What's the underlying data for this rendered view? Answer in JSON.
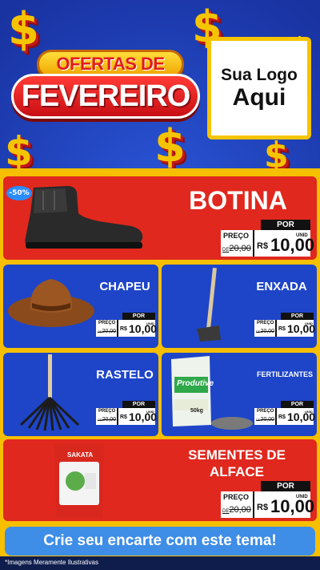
{
  "header": {
    "title_line1": "OFERTAS DE",
    "title_line2": "FEVEREIRO",
    "logo_line1": "Sua Logo",
    "logo_line2": "Aqui"
  },
  "decor": {
    "dollar_glyph": "$"
  },
  "products": [
    {
      "name": "BOTINA",
      "discount": "-50%",
      "por_label": "POR",
      "preco_label": "PREÇO",
      "old_price": "20,00",
      "de_prefix": "DE",
      "currency": "R$",
      "new_price": "10,00",
      "unit": "UNID",
      "icon": "boot-icon"
    },
    {
      "name": "CHAPEU",
      "por_label": "POR",
      "preco_label": "PREÇO",
      "old_price": "20,00",
      "de_prefix": "DE",
      "currency": "R$",
      "new_price": "10,00",
      "unit": "UNID",
      "icon": "hat-icon"
    },
    {
      "name": "ENXADA",
      "por_label": "POR",
      "preco_label": "PREÇO",
      "old_price": "20,00",
      "de_prefix": "DE",
      "currency": "R$",
      "new_price": "10,00",
      "unit": "UNID",
      "icon": "hoe-icon"
    },
    {
      "name": "RASTELO",
      "por_label": "POR",
      "preco_label": "PREÇO",
      "old_price": "20,00",
      "de_prefix": "DE",
      "currency": "R$",
      "new_price": "10,00",
      "unit": "UNID",
      "icon": "rake-icon"
    },
    {
      "name": "FERTILIZANTES",
      "por_label": "POR",
      "preco_label": "PREÇO",
      "old_price": "20,00",
      "de_prefix": "DE",
      "currency": "R$",
      "new_price": "10,00",
      "unit": "UNID",
      "icon": "fertilizer-bag-icon",
      "bag_brand": "Produtive",
      "bag_weight": "50kg"
    },
    {
      "name_line1": "SEMENTES DE",
      "name_line2": "ALFACE",
      "por_label": "POR",
      "preco_label": "PREÇO",
      "old_price": "20,00",
      "de_prefix": "DE",
      "currency": "R$",
      "new_price": "10,00",
      "unit": "UNID",
      "icon": "seed-packet-icon",
      "packet_brand": "SAKATA"
    }
  ],
  "cta": {
    "label": "Crie seu encarte com este tema!"
  },
  "footer": {
    "disclaimer": "*Imagens Meramente Ilustrativas"
  },
  "colors": {
    "background_blue": "#1f3aa8",
    "accent_yellow": "#f6bf00",
    "card_red": "#e0281e",
    "card_blue": "#1e45c8",
    "cta_blue": "#3e8de6"
  }
}
